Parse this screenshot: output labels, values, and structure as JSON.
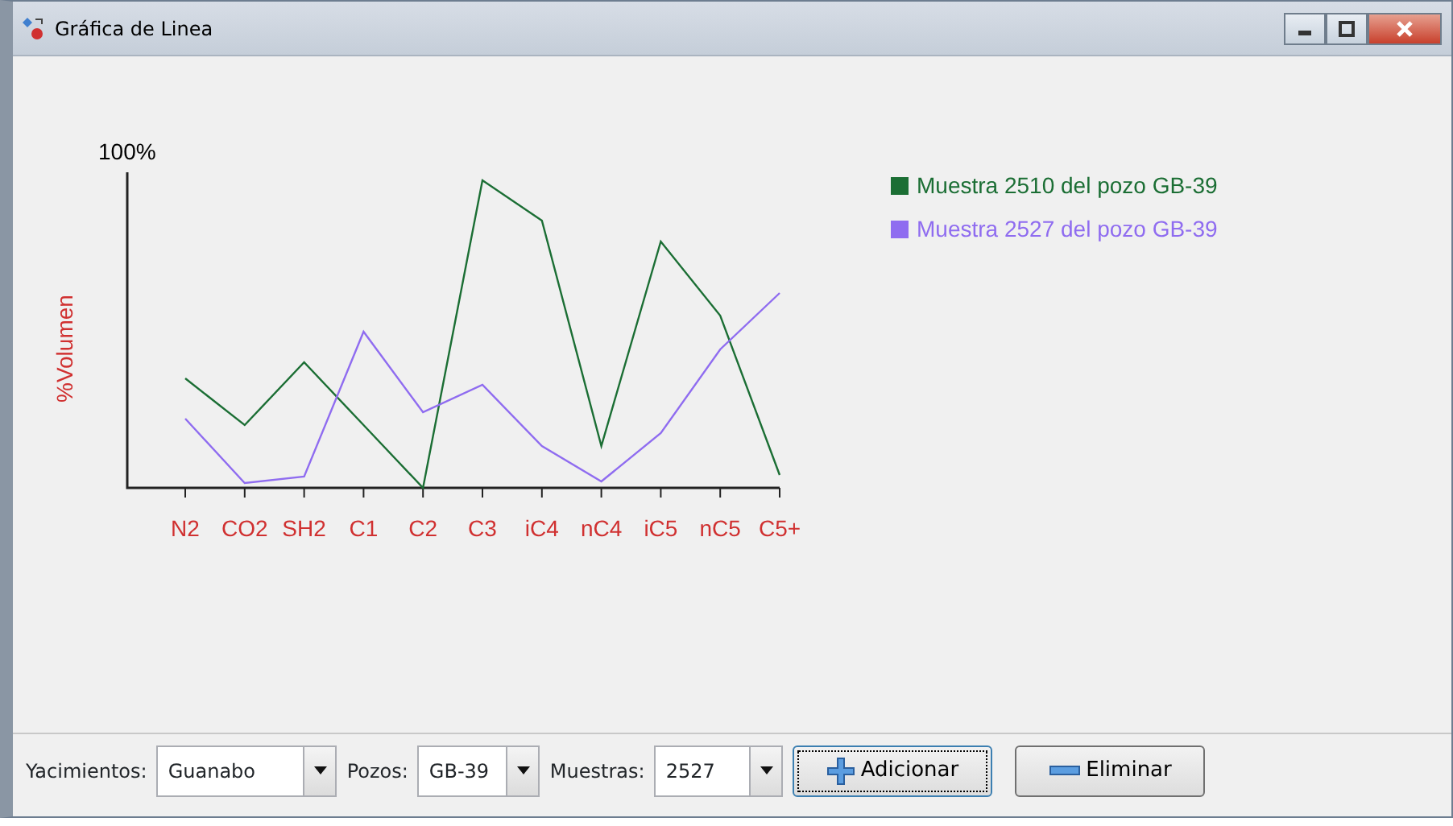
{
  "window": {
    "title": "Gráfica de Linea"
  },
  "chart": {
    "ytick": "100%",
    "ylabel": "%Volumen",
    "categories": [
      "N2",
      "CO2",
      "SH2",
      "C1",
      "C2",
      "C3",
      "iC4",
      "nC4",
      "iC5",
      "nC5",
      "C5+"
    ],
    "legend": [
      {
        "label": "Muestra 2510 del pozo GB-39",
        "color": "#1b6e34"
      },
      {
        "label": "Muestra 2527 del pozo GB-39",
        "color": "#8f6cf0"
      }
    ]
  },
  "toolbar": {
    "fields": [
      {
        "label": "Yacimientos:",
        "value": "Guanabo"
      },
      {
        "label": "Pozos:",
        "value": "GB-39"
      },
      {
        "label": "Muestras:",
        "value": "2527"
      }
    ],
    "buttons": [
      {
        "label": "Adicionar",
        "kind": "add",
        "focused": true
      },
      {
        "label": "Eliminar",
        "kind": "remove",
        "focused": false
      }
    ]
  }
}
